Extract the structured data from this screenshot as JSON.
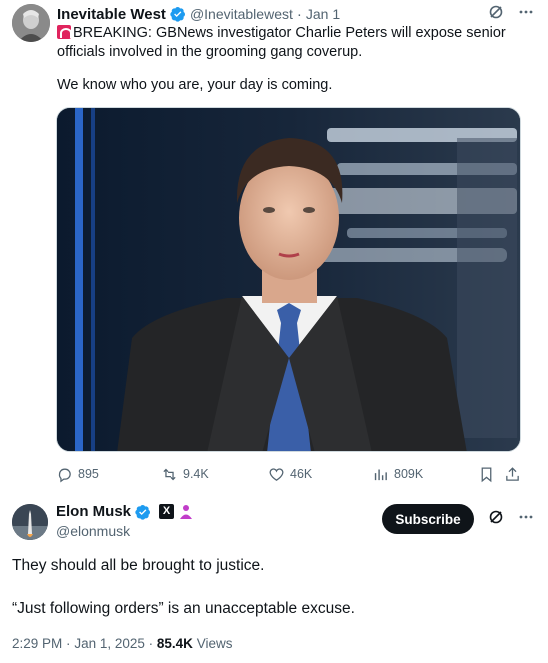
{
  "tweet": {
    "author_name": "Inevitable West",
    "handle": "@Inevitablewest",
    "separator": "·",
    "date": "Jan 1",
    "text_breaking": "BREAKING: GBNews investigator Charlie Peters will expose senior officials involved in the grooming gang coverup.",
    "text_line2": "We know who you are, your day is coming.",
    "icons": [
      "grok-icon",
      "more-icon",
      "verified-badge-icon",
      "siren-emoji-icon"
    ],
    "media_description_colors": {
      "bg": "#15202b",
      "suit": "#2a2a2c",
      "tie": "#3a5fa8"
    },
    "actions": {
      "replies": "895",
      "reposts": "9.4K",
      "likes": "46K",
      "views": "809K"
    }
  },
  "reply": {
    "author_name": "Elon Musk",
    "handle": "@elonmusk",
    "subscribe_label": "Subscribe",
    "x_badge": "X",
    "text_p1": "They should all be brought to justice.",
    "text_p2": "“Just following orders” is an unacceptable excuse.",
    "time": "2:29 PM",
    "sep": "·",
    "date": "Jan 1, 2025",
    "sep2": "·",
    "views_count": "85.4K",
    "views_label": "Views"
  },
  "colors": {
    "accent": "#1d9bf0",
    "text": "#0f1419",
    "muted": "#536471",
    "border": "#cfd9de"
  }
}
